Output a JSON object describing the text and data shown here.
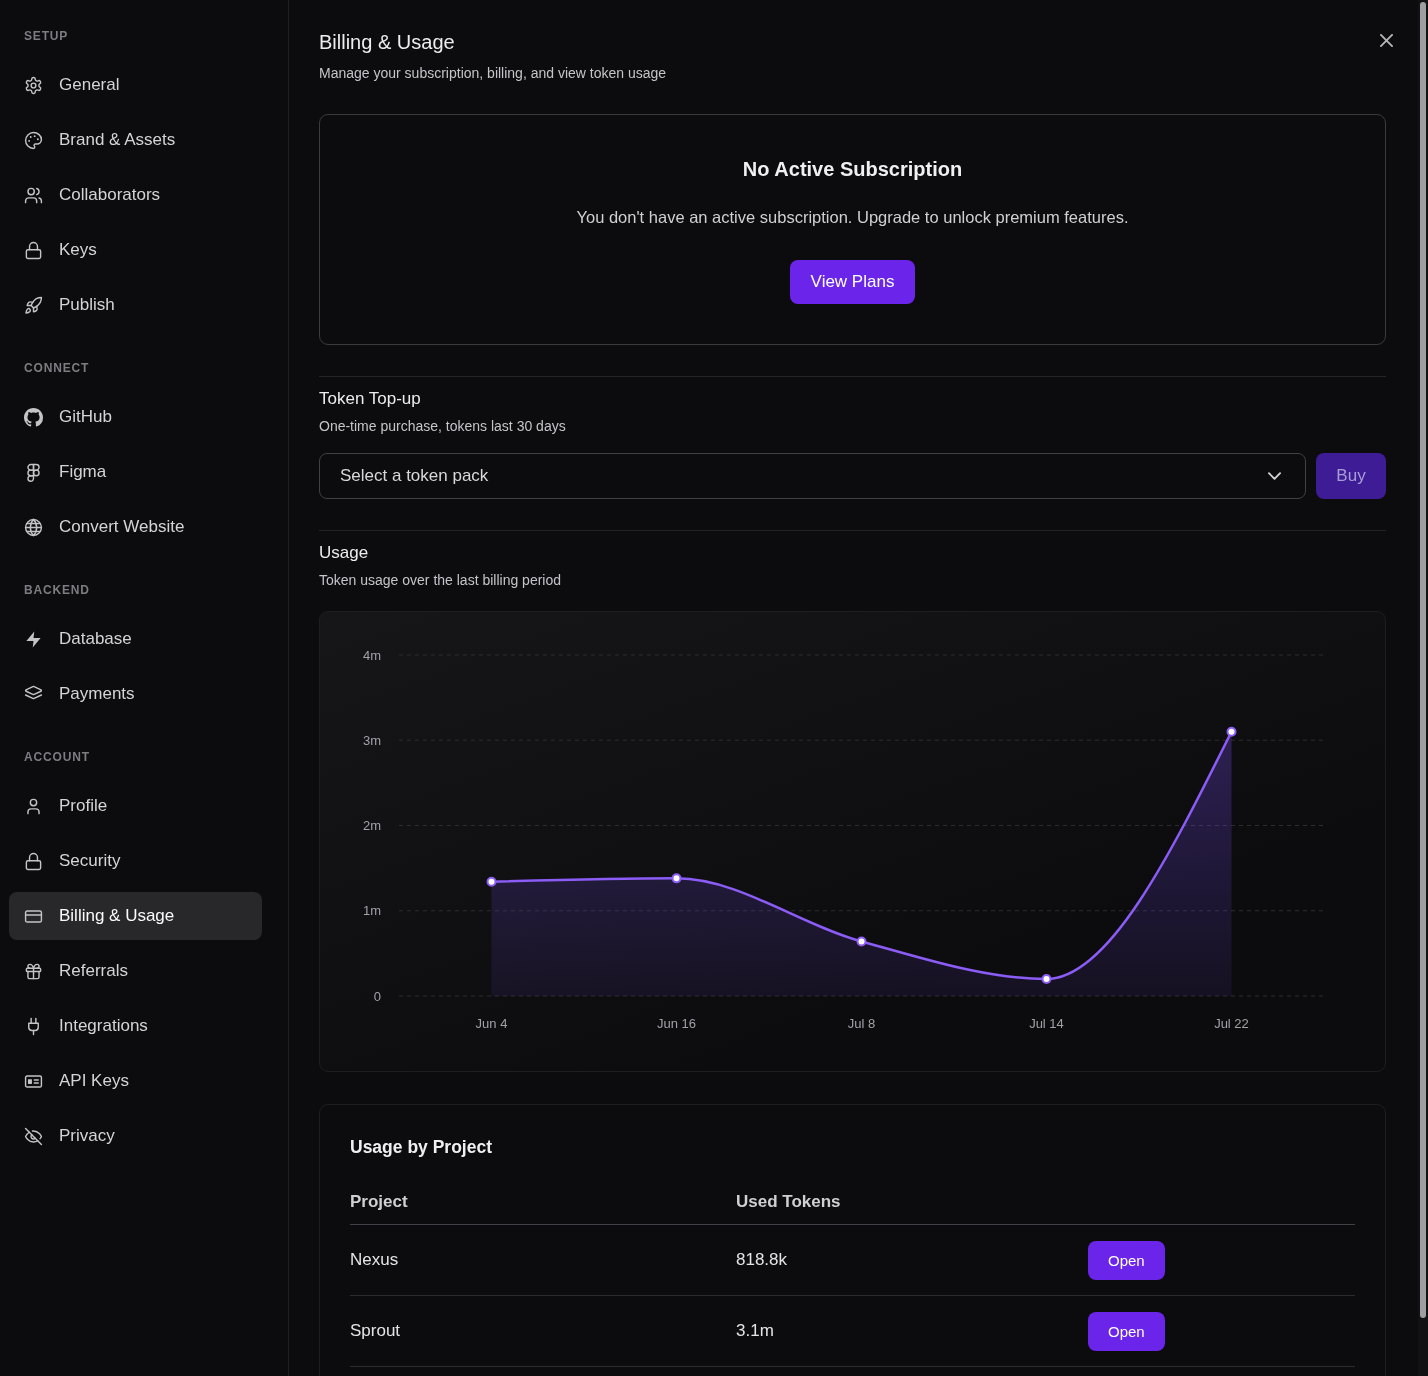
{
  "sidebar": {
    "sections": [
      {
        "heading": "SETUP",
        "items": [
          {
            "label": "General",
            "selected": false
          },
          {
            "label": "Brand & Assets",
            "selected": false
          },
          {
            "label": "Collaborators",
            "selected": false
          },
          {
            "label": "Keys",
            "selected": false
          },
          {
            "label": "Publish",
            "selected": false
          }
        ]
      },
      {
        "heading": "CONNECT",
        "items": [
          {
            "label": "GitHub",
            "selected": false
          },
          {
            "label": "Figma",
            "selected": false
          },
          {
            "label": "Convert Website",
            "selected": false
          }
        ]
      },
      {
        "heading": "BACKEND",
        "items": [
          {
            "label": "Database",
            "selected": false
          },
          {
            "label": "Payments",
            "selected": false
          }
        ]
      },
      {
        "heading": "ACCOUNT",
        "items": [
          {
            "label": "Profile",
            "selected": false
          },
          {
            "label": "Security",
            "selected": false
          },
          {
            "label": "Billing & Usage",
            "selected": true
          },
          {
            "label": "Referrals",
            "selected": false
          },
          {
            "label": "Integrations",
            "selected": false
          },
          {
            "label": "API Keys",
            "selected": false
          },
          {
            "label": "Privacy",
            "selected": false
          }
        ]
      }
    ]
  },
  "header": {
    "title": "Billing & Usage",
    "subtitle": "Manage your subscription, billing, and view token usage"
  },
  "subscription": {
    "title": "No Active Subscription",
    "message": "You don't have an active subscription. Upgrade to unlock premium features.",
    "button": "View Plans"
  },
  "token_topup": {
    "title": "Token Top-up",
    "subtitle": "One-time purchase, tokens last 30 days",
    "select": {
      "placeholder": "Select a token pack"
    },
    "buy_button": {
      "label": "Buy",
      "disabled": true
    }
  },
  "usage": {
    "title": "Usage",
    "subtitle": "Token usage over the last billing period",
    "chart_data": {
      "type": "area",
      "categories": [
        "Jun 4",
        "Jun 16",
        "Jul 8",
        "Jul 14",
        "Jul 22"
      ],
      "values": [
        1.34,
        1.38,
        0.64,
        0.2,
        3.1
      ],
      "ylim": [
        0,
        4
      ],
      "yticks": [
        {
          "value": 0,
          "label": "0"
        },
        {
          "value": 1,
          "label": "1m"
        },
        {
          "value": 2,
          "label": "2m"
        },
        {
          "value": 3,
          "label": "3m"
        },
        {
          "value": 4,
          "label": "4m"
        }
      ],
      "grid": true
    }
  },
  "project_usage": {
    "title": "Usage by Project",
    "columns": [
      "Project",
      "Used Tokens"
    ],
    "rows": [
      {
        "project": "Nexus",
        "used_tokens": "818.8k",
        "button": "Open"
      },
      {
        "project": "Sprout",
        "used_tokens": "3.1m",
        "button": "Open"
      }
    ]
  }
}
